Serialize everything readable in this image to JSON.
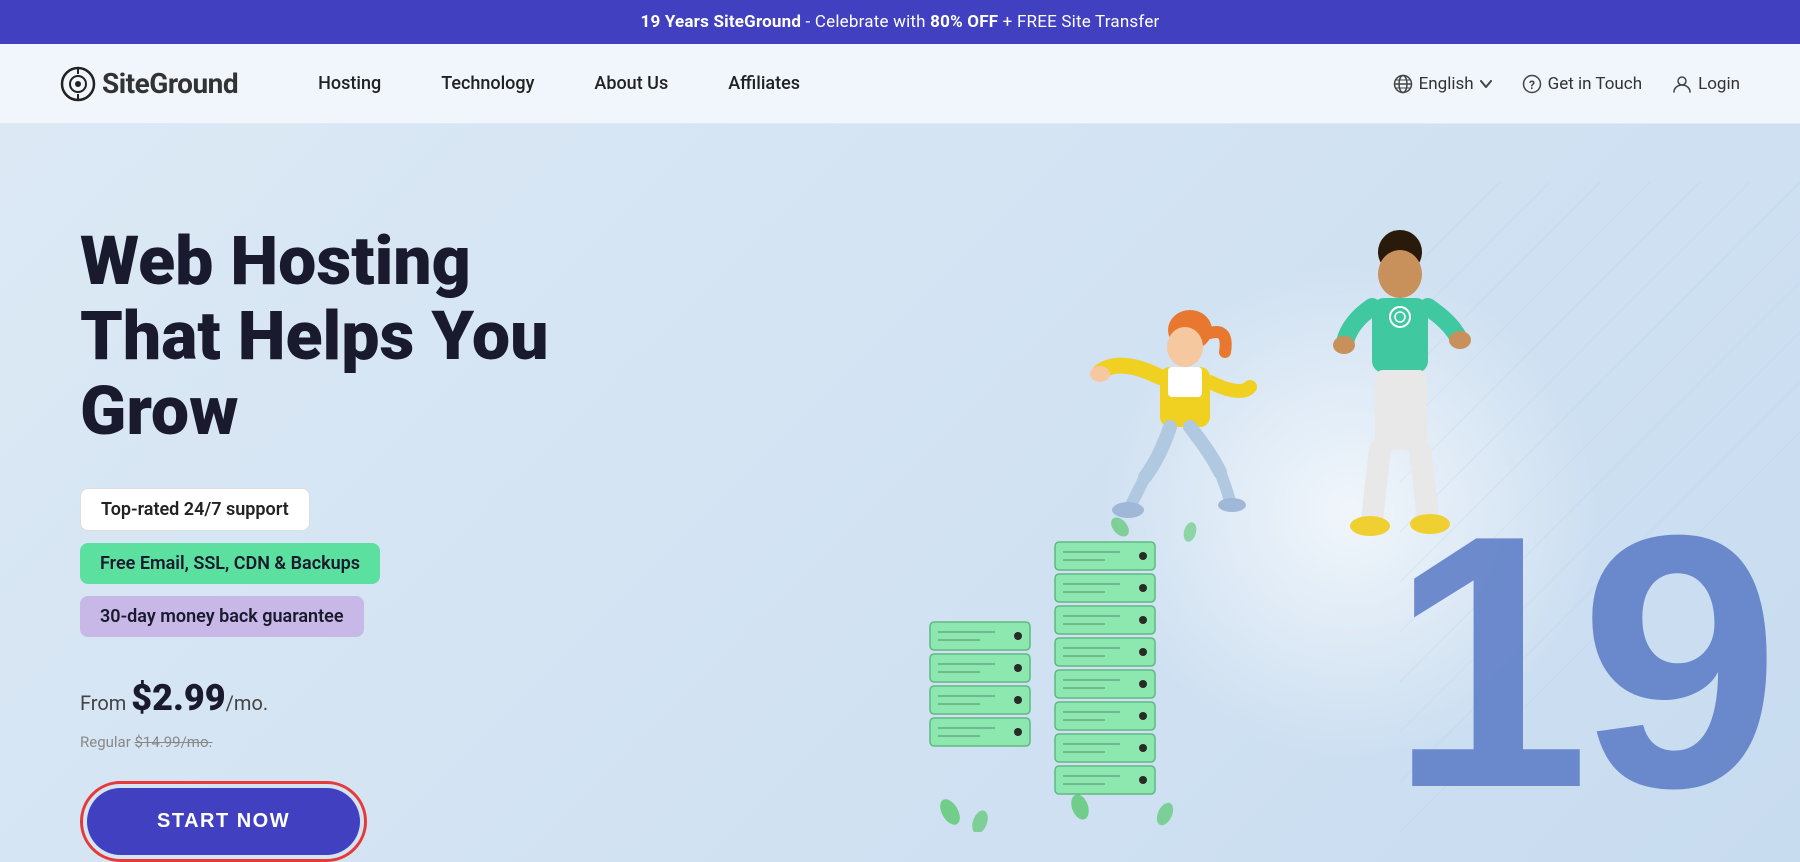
{
  "banner": {
    "text_pre": "19 Years SiteGround",
    "text_mid": " - Celebrate with ",
    "text_bold": "80% OFF",
    "text_post": " + FREE Site Transfer"
  },
  "nav": {
    "logo": "SiteGround",
    "links": [
      {
        "label": "Hosting",
        "id": "hosting"
      },
      {
        "label": "Technology",
        "id": "technology"
      },
      {
        "label": "About Us",
        "id": "about-us"
      },
      {
        "label": "Affiliates",
        "id": "affiliates"
      }
    ],
    "language": "English",
    "get_in_touch": "Get in Touch",
    "login": "Login"
  },
  "hero": {
    "title_line1": "Web Hosting",
    "title_line2": "That Helps You Grow",
    "features": [
      {
        "text": "Top-rated 24/7 support",
        "style": "plain"
      },
      {
        "text": "Free Email, SSL, CDN & Backups",
        "style": "green"
      },
      {
        "text": "30-day money back guarantee",
        "style": "purple"
      }
    ],
    "price_from": "From ",
    "price_amount": "$2.99",
    "price_per": "/mo.",
    "price_regular_label": "Regular ",
    "price_regular": "$14.99/mo.",
    "cta_button": "START NOW",
    "number_badge": "19"
  },
  "colors": {
    "banner_bg": "#4040c0",
    "hero_bg": "#dce9f5",
    "button_bg": "#4040c0",
    "button_border": "#e63939",
    "feature_green": "#5ce0a0",
    "feature_purple": "#c8b8e8",
    "number_color": "#6080c8"
  }
}
